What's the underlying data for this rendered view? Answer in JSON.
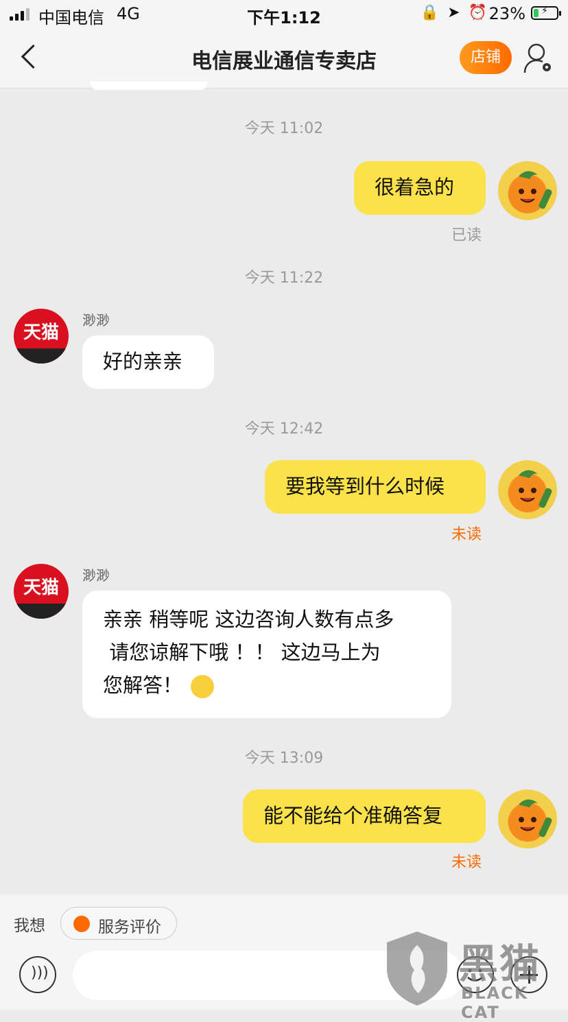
{
  "status_bar": {
    "carrier": "中国电信",
    "network": "4G",
    "time": "下午1:12",
    "battery_percent": "23%",
    "battery_level": 0.23
  },
  "nav": {
    "title": "电信展业通信专卖店",
    "shop_label": "店铺"
  },
  "messages": [
    {
      "timestamp": "今天 11:02",
      "direction": "out",
      "text": "很着急的",
      "status": "已读"
    },
    {
      "timestamp": "今天 11:22",
      "direction": "in",
      "sender": "渺渺",
      "text": "好的亲亲"
    },
    {
      "timestamp": "今天 12:42",
      "direction": "out",
      "text": "要我等到什么时候",
      "status": "未读"
    },
    {
      "direction": "in",
      "sender": "渺渺",
      "lines": [
        "亲亲 稍等呢 这边咨询人数有点多",
        " 请您谅解下哦 ！！ 这边马上为",
        "您解答！"
      ]
    },
    {
      "timestamp": "今天 13:09",
      "direction": "out",
      "text": "能不能给个准确答复",
      "status": "未读"
    }
  ],
  "shop_avatar_text": "天猫",
  "bottom": {
    "want_label": "我想",
    "service_chip": "服务评价",
    "input_placeholder": ""
  },
  "watermark": {
    "cn": "黑猫",
    "en": "BLACK CAT"
  },
  "colors": {
    "accent": "#ff6a00",
    "outgoing_bubble": "#fbe14a",
    "unread": "#ff6a00"
  }
}
